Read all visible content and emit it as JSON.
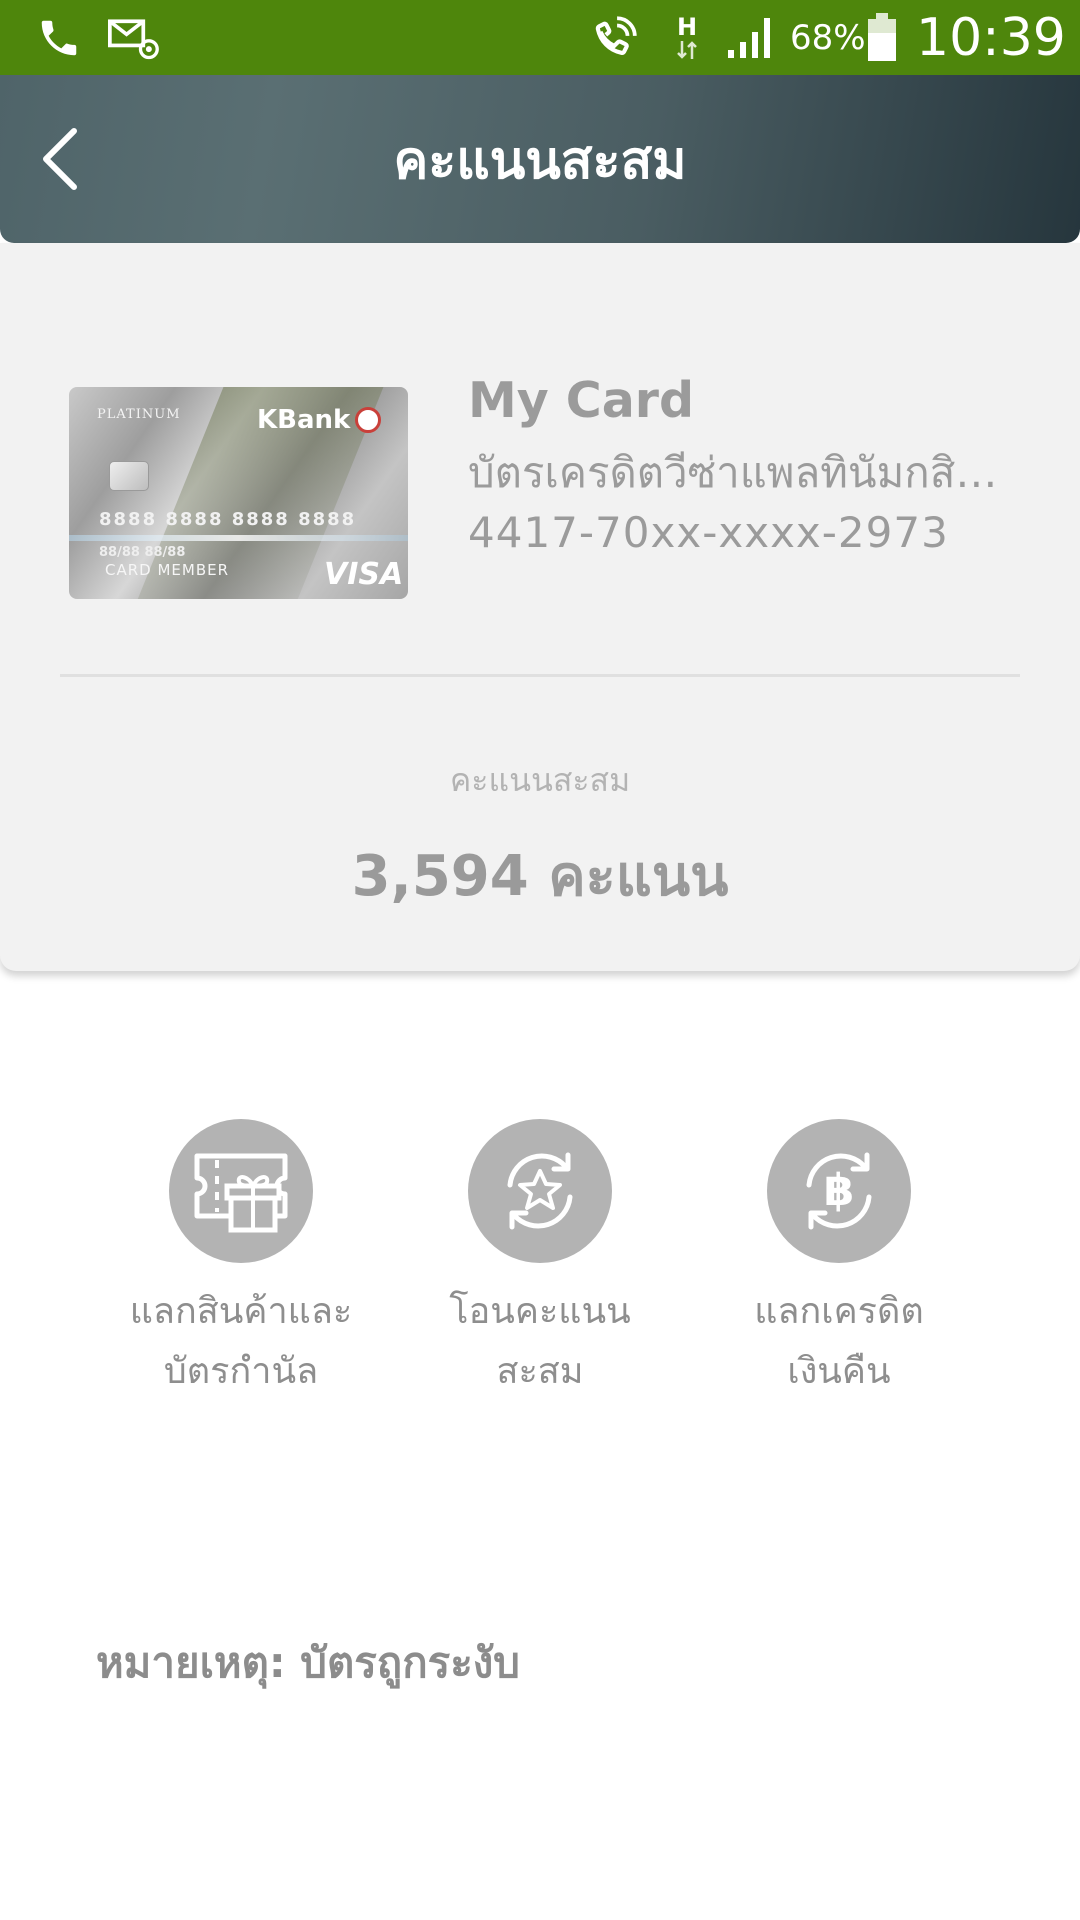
{
  "status_bar": {
    "battery_percent": "68%",
    "time": "10:39",
    "network_type": "H",
    "icons": [
      "phone-icon",
      "email-at-icon",
      "wifi-calling-icon",
      "network-type-icon",
      "signal-icon",
      "battery-icon"
    ]
  },
  "header": {
    "title": "คะแนนสะสม",
    "back_icon": "chevron-left-icon"
  },
  "card": {
    "name": "My Card",
    "type": "บัตรเครดิตวีซ่าแพลทินัมกสิก...",
    "masked_number": "4417-70xx-xxxx-2973",
    "image": {
      "tier": "PLATINUM",
      "brand": "KBank",
      "number": "8888 8888 8888 8888",
      "dates": "88/88   88/88",
      "holder": "CARD MEMBER",
      "network": "VISA"
    }
  },
  "points": {
    "label": "คะแนนสะสม",
    "value": "3,594 คะแนน"
  },
  "actions": [
    {
      "line1": "แลกสินค้าและ",
      "line2": "บัตรกำนัล",
      "icon": "gift-voucher-icon"
    },
    {
      "line1": "โอนคะแนน",
      "line2": "สะสม",
      "icon": "star-transfer-icon"
    },
    {
      "line1": "แลกเครดิต",
      "line2": "เงินคืน",
      "icon": "baht-cashback-icon"
    }
  ],
  "note": "หมายเหตุ: บัตรถูกระงับ",
  "colors": {
    "status_bar": "#4e860c",
    "header_start": "#5a6f73",
    "header_end": "#26363d",
    "panel": "#f2f2f2",
    "icon_circle": "#b3b3b3",
    "text_gray": "#9b9b9b"
  }
}
